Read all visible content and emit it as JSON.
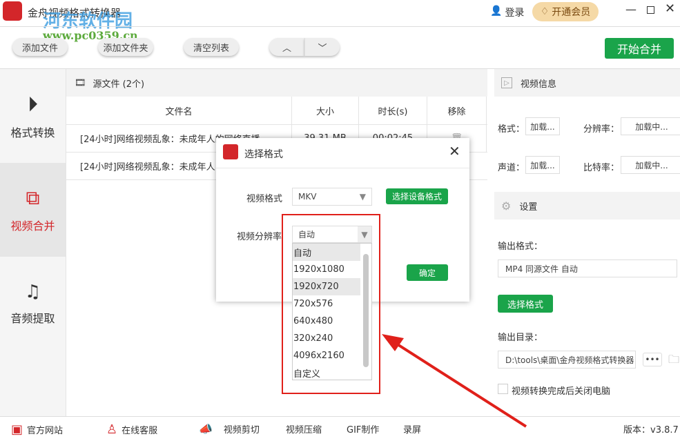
{
  "app": {
    "title": "金舟视频格式转换器",
    "watermark_name": "河东软件园",
    "watermark_url": "www.pc0359.cn",
    "login": "登录",
    "vip": "开通会员"
  },
  "toolbar": {
    "add_file": "添加文件",
    "add_folder": "添加文件夹",
    "clear_list": "清空列表",
    "start_merge": "开始合并"
  },
  "sidebar": {
    "items": [
      {
        "label": "格式转换"
      },
      {
        "label": "视频合并"
      },
      {
        "label": "音频提取"
      }
    ]
  },
  "main": {
    "source_header": "源文件 (2个)",
    "columns": [
      "文件名",
      "大小",
      "时长(s)",
      "移除"
    ],
    "rows": [
      {
        "name": "[24小时]网络视频乱象：未成年人的网络直播",
        "size": "39.31 MB",
        "duration": "00:02:45"
      },
      {
        "name": "[24小时]网络视频乱象：未成年人",
        "size": "",
        "duration": ""
      }
    ]
  },
  "right": {
    "info_title": "视频信息",
    "format_label": "格式：",
    "format_val": "加载...",
    "res_label": "分辨率：",
    "res_val": "加载中...",
    "channel_label": "声道：",
    "channel_val": "加载...",
    "bitrate_label": "比特率：",
    "bitrate_val": "加载中...",
    "settings_title": "设置",
    "out_format_label": "输出格式：",
    "out_format_val": "MP4 同源文件 自动",
    "choose_format": "选择格式",
    "out_dir_label": "输出目录：",
    "out_dir_val": "D:\\tools\\桌面\\金舟视频格式转换器",
    "shutdown": "视频转换完成后关闭电脑"
  },
  "dialog": {
    "title": "选择格式",
    "video_format_label": "视频格式",
    "video_format_val": "MKV",
    "device_btn": "选择设备格式",
    "res_label": "视频分辨率",
    "res_val": "自动",
    "ok": "确定",
    "options": [
      "自动",
      "1920x1080",
      "1920x720",
      "720x576",
      "640x480",
      "320x240",
      "4096x2160",
      "自定义"
    ]
  },
  "footer": {
    "website": "官方网站",
    "support": "在线客服",
    "cut": "视频剪切",
    "compress": "视频压缩",
    "gif": "GIF制作",
    "record": "录屏",
    "version": "版本：v3.8.7"
  },
  "colors": {
    "accent": "#1aa44a",
    "red": "#e0201a",
    "vip": "#f5d9a6"
  }
}
